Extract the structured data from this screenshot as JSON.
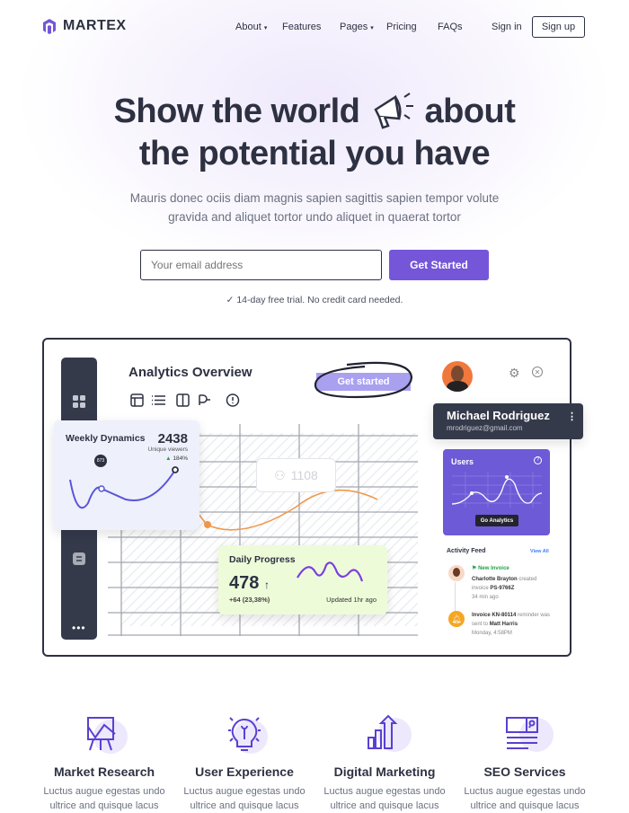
{
  "brand": {
    "name": "MARTEX",
    "accent": "#7556d9"
  },
  "nav": {
    "items": [
      "About",
      "Features",
      "Pages",
      "Pricing",
      "FAQs"
    ],
    "signin": "Sign in",
    "signup": "Sign up"
  },
  "hero": {
    "line1a": "Show the world",
    "line1b": "about",
    "line2": "the potential you have",
    "subtitle1": "Mauris donec ociis diam magnis sapien sagittis sapien tempor volute",
    "subtitle2": "gravida and aliquet tortor undo aliquet in quaerat tortor",
    "email_placeholder": "Your email address",
    "cta": "Get Started",
    "trial": "14-day free trial. No credit card needed."
  },
  "dashboard": {
    "title": "Analytics Overview",
    "get_started": "Get started",
    "ghost_value": "1108",
    "weekly": {
      "title": "Weekly Dynamics",
      "value": "2438",
      "label": "Unique viewers",
      "change": "184%",
      "pin": "873"
    },
    "daily": {
      "title": "Daily Progress",
      "value": "478",
      "change": "+64 (23,38%)",
      "updated": "Updated 1hr ago"
    },
    "profile": {
      "name": "Michael Rodriguez",
      "email": "mrodriguez@gmail.com"
    },
    "users": {
      "title": "Users",
      "button": "Go Analytics"
    },
    "feed": {
      "title": "Activity Feed",
      "view_all": "View All",
      "item1": {
        "tag": "New Invoice",
        "who": "Charlotte Brayton",
        "action": "created invoice",
        "ref": "PS-9766Z",
        "time": "34 min ago"
      },
      "item2": {
        "ref": "Invoice KN-80114",
        "action": "reminder was sent to",
        "who": "Matt Harris",
        "time": "Monday, 4:58PM"
      }
    }
  },
  "features": [
    {
      "title": "Market Research",
      "desc1": "Luctus augue egestas undo",
      "desc2": "ultrice and quisque lacus"
    },
    {
      "title": "User Experience",
      "desc1": "Luctus augue egestas undo",
      "desc2": "ultrice and quisque lacus"
    },
    {
      "title": "Digital Marketing",
      "desc1": "Luctus augue egestas undo",
      "desc2": "ultrice and quisque lacus"
    },
    {
      "title": "SEO Services",
      "desc1": "Luctus augue egestas undo",
      "desc2": "ultrice and quisque lacus"
    }
  ]
}
